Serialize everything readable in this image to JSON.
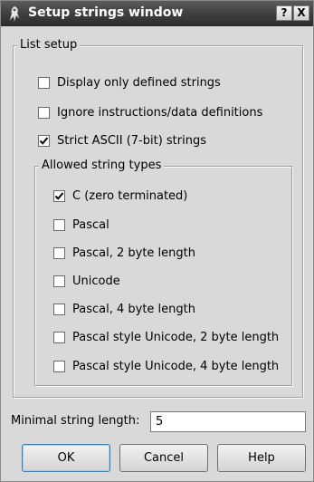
{
  "window": {
    "title": "Setup strings window",
    "help_button": "?",
    "close_button": "X"
  },
  "list_setup": {
    "legend": "List setup",
    "options": [
      {
        "label": "Display only defined strings",
        "checked": false
      },
      {
        "label": "Ignore instructions/data definitions",
        "checked": false
      },
      {
        "label": "Strict ASCII (7-bit) strings",
        "checked": true
      }
    ]
  },
  "allowed_types": {
    "legend": "Allowed string types",
    "items": [
      {
        "label": "C (zero terminated)",
        "checked": true
      },
      {
        "label": "Pascal",
        "checked": false
      },
      {
        "label": "Pascal, 2 byte length",
        "checked": false
      },
      {
        "label": "Unicode",
        "checked": false
      },
      {
        "label": "Pascal, 4 byte length",
        "checked": false
      },
      {
        "label": "Pascal style Unicode, 2 byte length",
        "checked": false
      },
      {
        "label": "Pascal style Unicode, 4 byte length",
        "checked": false
      }
    ]
  },
  "min_length": {
    "label": "Minimal string length:",
    "value": "5"
  },
  "buttons": {
    "ok": "OK",
    "cancel": "Cancel",
    "help": "Help"
  }
}
